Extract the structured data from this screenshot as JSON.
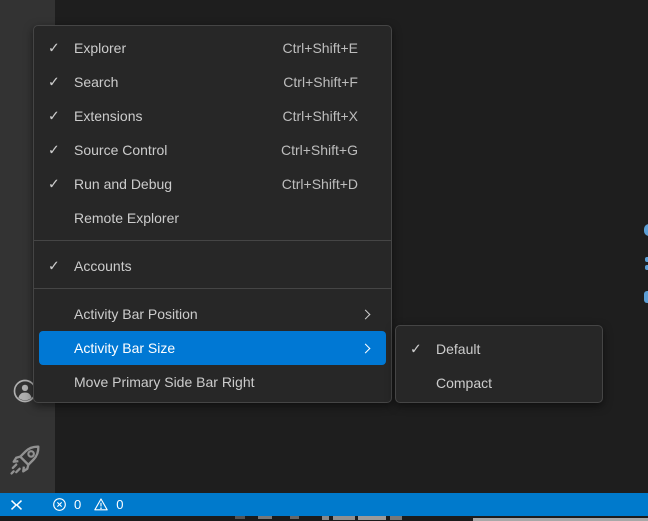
{
  "icons": {
    "check": "✓"
  },
  "view_menu": {
    "items": [
      {
        "type": "item",
        "label": "Explorer",
        "shortcut": "Ctrl+Shift+E",
        "checked": true
      },
      {
        "type": "item",
        "label": "Search",
        "shortcut": "Ctrl+Shift+F",
        "checked": true
      },
      {
        "type": "item",
        "label": "Extensions",
        "shortcut": "Ctrl+Shift+X",
        "checked": true
      },
      {
        "type": "item",
        "label": "Source Control",
        "shortcut": "Ctrl+Shift+G",
        "checked": true
      },
      {
        "type": "item",
        "label": "Run and Debug",
        "shortcut": "Ctrl+Shift+D",
        "checked": true
      },
      {
        "type": "item",
        "label": "Remote Explorer"
      },
      {
        "type": "separator"
      },
      {
        "type": "item",
        "label": "Accounts",
        "checked": true
      },
      {
        "type": "separator"
      },
      {
        "type": "item",
        "label": "Activity Bar Position",
        "submenu": true
      },
      {
        "type": "item",
        "label": "Activity Bar Size",
        "submenu": true,
        "highlighted": true
      },
      {
        "type": "item",
        "label": "Move Primary Side Bar Right"
      }
    ]
  },
  "size_submenu": {
    "items": [
      {
        "type": "item",
        "label": "Default",
        "checked": true
      },
      {
        "type": "item",
        "label": "Compact"
      }
    ]
  },
  "status_bar": {
    "error_count": "0",
    "warning_count": "0"
  },
  "colors": {
    "menu_highlight": "#0078d4",
    "status_bar": "#007acc",
    "activity_bar": "#333333",
    "menu_background": "#272727",
    "editor_background": "#1e1e1e"
  }
}
